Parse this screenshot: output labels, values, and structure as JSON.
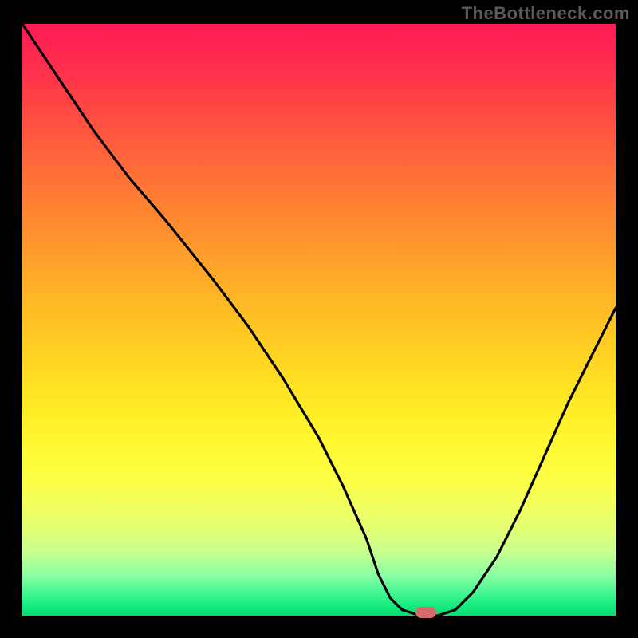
{
  "watermark": "TheBottleneck.com",
  "colors": {
    "frame_bg": "#000000",
    "watermark_text": "#5a5a5a",
    "curve_stroke": "#000000",
    "marker_fill": "#d66b6b",
    "gradient_top": "#ff1a55",
    "gradient_bottom": "#06df70"
  },
  "chart_data": {
    "type": "line",
    "title": "",
    "xlabel": "",
    "ylabel": "",
    "x_range": [
      0,
      100
    ],
    "y_range": [
      0,
      100
    ],
    "grid": false,
    "legend": false,
    "background": "vertical_gradient_red_to_green",
    "series": [
      {
        "name": "bottleneck-curve",
        "x": [
          0,
          6,
          12,
          18,
          24,
          28,
          32,
          38,
          44,
          50,
          54,
          58,
          60,
          62,
          64,
          67,
          70,
          73,
          76,
          80,
          84,
          88,
          92,
          96,
          100
        ],
        "y": [
          100,
          91,
          82,
          74,
          67,
          62,
          57,
          49,
          40,
          30,
          22,
          13,
          7,
          3,
          1,
          0,
          0,
          1,
          4,
          10,
          18,
          27,
          36,
          44,
          52
        ]
      }
    ],
    "marker": {
      "x": 68,
      "y": 0.5,
      "shape": "pill",
      "color": "#d66b6b"
    }
  }
}
